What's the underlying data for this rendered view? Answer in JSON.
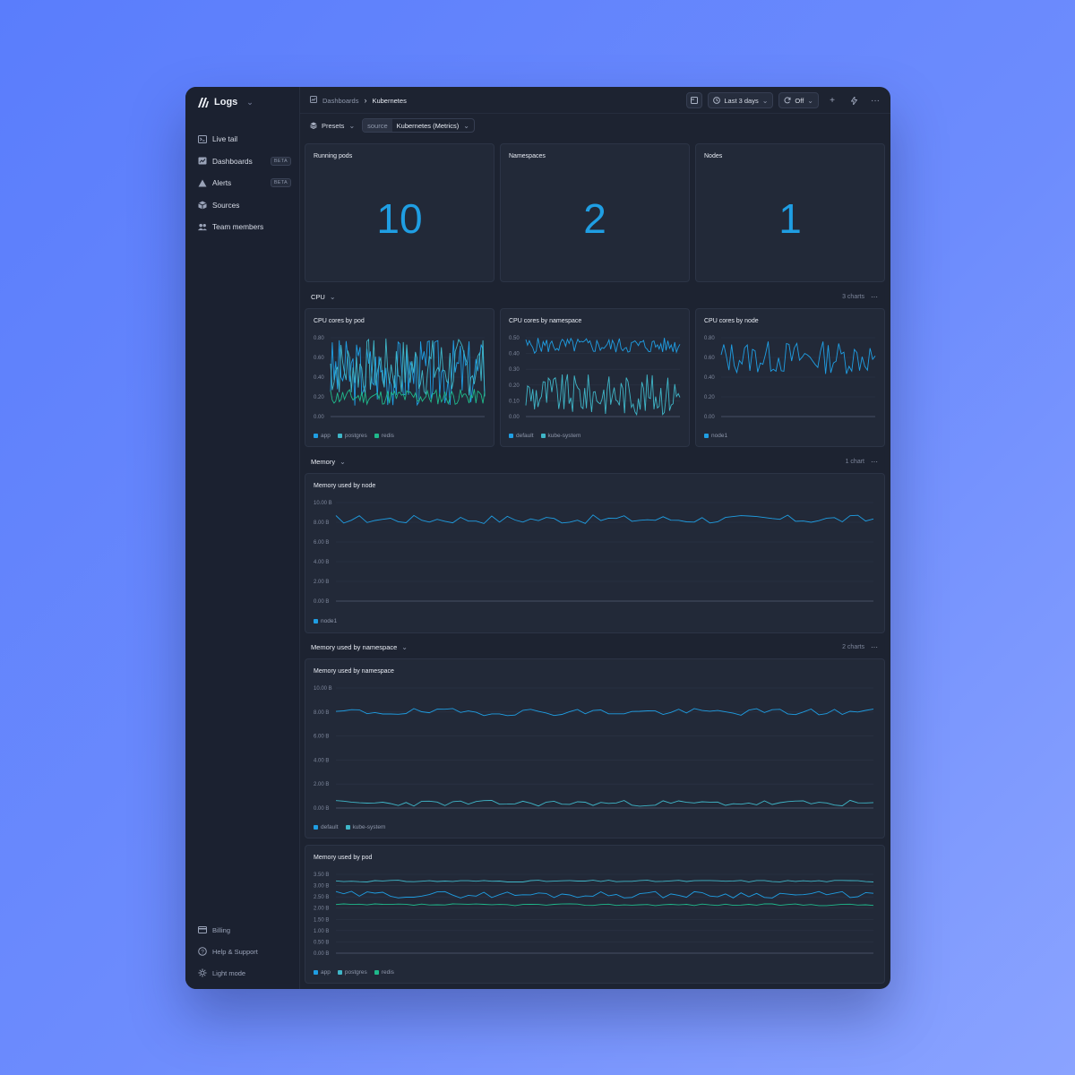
{
  "app": {
    "name": "Logs"
  },
  "sidebar": {
    "items": [
      {
        "label": "Live tail",
        "icon": "terminal-icon"
      },
      {
        "label": "Dashboards",
        "icon": "chart-icon",
        "badge": "BETA"
      },
      {
        "label": "Alerts",
        "icon": "warning-icon",
        "badge": "BETA"
      },
      {
        "label": "Sources",
        "icon": "cube-icon"
      },
      {
        "label": "Team members",
        "icon": "users-icon"
      }
    ],
    "bottom": [
      {
        "label": "Billing",
        "icon": "card-icon"
      },
      {
        "label": "Help & Support",
        "icon": "help-icon"
      },
      {
        "label": "Light mode",
        "icon": "sun-icon"
      }
    ]
  },
  "topbar": {
    "breadcrumb": [
      "Dashboards",
      "Kubernetes"
    ],
    "time_range": "Last 3 days",
    "refresh": "Off"
  },
  "subbar": {
    "presets_label": "Presets",
    "source_key": "source",
    "source_value": "Kubernetes (Metrics)"
  },
  "stats": [
    {
      "title": "Running pods",
      "value": "10"
    },
    {
      "title": "Namespaces",
      "value": "2"
    },
    {
      "title": "Nodes",
      "value": "1"
    }
  ],
  "sections": {
    "cpu": {
      "title": "CPU",
      "count": "3 charts"
    },
    "memory": {
      "title": "Memory",
      "count": "1 chart"
    },
    "memns": {
      "title": "Memory used by namespace",
      "count": "2 charts"
    }
  },
  "colors": {
    "blue": "#1f9ee3",
    "teal": "#3fb6c8",
    "green": "#1fb98b",
    "accent": "#1f9ee3"
  },
  "chart_data": [
    {
      "id": "cpu_pod",
      "type": "line",
      "title": "CPU cores by pod",
      "ylim": [
        0,
        0.8
      ],
      "yticks": [
        "0.80",
        "0.60",
        "0.40",
        "0.20",
        "0.00"
      ],
      "tickvals": [
        0.8,
        0.6,
        0.4,
        0.2,
        0
      ],
      "series": [
        {
          "name": "app",
          "color": "#1f9ee3",
          "center": 0.45,
          "amp": 0.35,
          "seed": 3
        },
        {
          "name": "postgres",
          "color": "#3fb6c8",
          "center": 0.5,
          "amp": 0.3,
          "seed": 7
        },
        {
          "name": "redis",
          "color": "#1fb98b",
          "center": 0.2,
          "amp": 0.08,
          "seed": 11
        }
      ]
    },
    {
      "id": "cpu_ns",
      "type": "line",
      "title": "CPU cores by namespace",
      "ylim": [
        0,
        0.5
      ],
      "yticks": [
        "0.50",
        "0.40",
        "0.30",
        "0.20",
        "0.10",
        "0.00"
      ],
      "tickvals": [
        0.5,
        0.4,
        0.3,
        0.2,
        0.1,
        0
      ],
      "series": [
        {
          "name": "default",
          "color": "#1f9ee3",
          "center": 0.45,
          "amp": 0.05,
          "seed": 5
        },
        {
          "name": "kube-system",
          "color": "#3fb6c8",
          "center": 0.14,
          "amp": 0.13,
          "seed": 9
        }
      ]
    },
    {
      "id": "cpu_node",
      "type": "line",
      "title": "CPU cores by node",
      "ylim": [
        0,
        0.8
      ],
      "yticks": [
        "0.80",
        "0.60",
        "0.40",
        "0.20",
        "0.00"
      ],
      "tickvals": [
        0.8,
        0.6,
        0.4,
        0.2,
        0
      ],
      "series": [
        {
          "name": "node1",
          "color": "#1f9ee3",
          "center": 0.6,
          "amp": 0.17,
          "seed": 13
        }
      ]
    },
    {
      "id": "mem_node",
      "type": "line",
      "title": "Memory used by node",
      "ylim": [
        0,
        10
      ],
      "yticks": [
        "10.00 B",
        "8.00 B",
        "6.00 B",
        "4.00 B",
        "2.00 B",
        "0.00 B"
      ],
      "tickvals": [
        10,
        8,
        6,
        4,
        2,
        0
      ],
      "series": [
        {
          "name": "node1",
          "color": "#1f9ee3",
          "center": 8.3,
          "amp": 0.45,
          "seed": 17
        }
      ]
    },
    {
      "id": "mem_ns",
      "type": "line",
      "title": "Memory used by namespace",
      "ylim": [
        0,
        10
      ],
      "yticks": [
        "10.00 B",
        "8.00 B",
        "6.00 B",
        "4.00 B",
        "2.00 B",
        "0.00 B"
      ],
      "tickvals": [
        10,
        8,
        6,
        4,
        2,
        0
      ],
      "series": [
        {
          "name": "default",
          "color": "#1f9ee3",
          "center": 8.0,
          "amp": 0.3,
          "seed": 19
        },
        {
          "name": "kube-system",
          "color": "#3fb6c8",
          "center": 0.4,
          "amp": 0.25,
          "seed": 23
        }
      ]
    },
    {
      "id": "mem_pod",
      "type": "line",
      "title": "Memory used by pod",
      "ylim": [
        0,
        3.5
      ],
      "yticks": [
        "3.50 B",
        "3.00 B",
        "2.50 B",
        "2.00 B",
        "1.50 B",
        "1.00 B",
        "0.50 B",
        "0.00 B"
      ],
      "tickvals": [
        3.5,
        3,
        2.5,
        2,
        1.5,
        1,
        0.5,
        0
      ],
      "series": [
        {
          "name": "app",
          "color": "#1f9ee3",
          "center": 2.6,
          "amp": 0.15,
          "seed": 29
        },
        {
          "name": "postgres",
          "color": "#3fb6c8",
          "center": 3.2,
          "amp": 0.04,
          "seed": 31
        },
        {
          "name": "redis",
          "color": "#1fb98b",
          "center": 2.15,
          "amp": 0.04,
          "seed": 37
        }
      ]
    }
  ]
}
